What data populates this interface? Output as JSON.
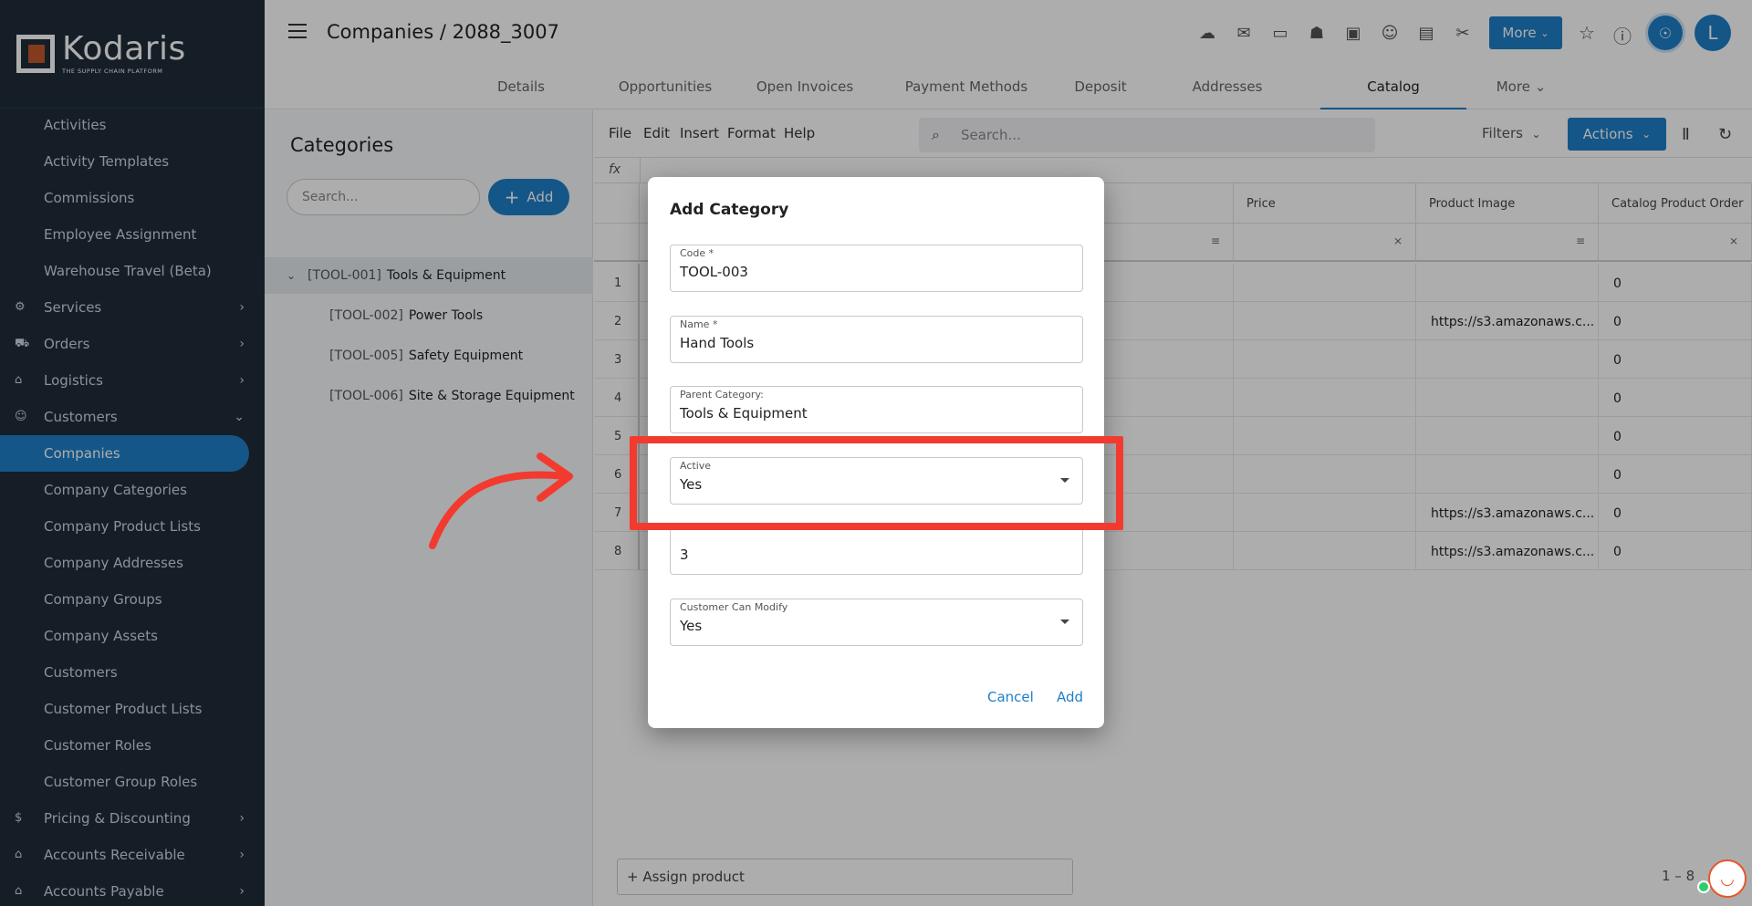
{
  "brand": {
    "name": "Kodaris",
    "tagline": "THE SUPPLY CHAIN PLATFORM"
  },
  "sidebar": {
    "items": [
      {
        "label": "Activities",
        "type": "sub"
      },
      {
        "label": "Activity Templates",
        "type": "sub"
      },
      {
        "label": "Commissions",
        "type": "sub"
      },
      {
        "label": "Employee Assignment",
        "type": "sub"
      },
      {
        "label": "Warehouse Travel (Beta)",
        "type": "sub"
      },
      {
        "label": "Services",
        "type": "section",
        "icon": "services-icon"
      },
      {
        "label": "Orders",
        "type": "section",
        "icon": "truck-icon"
      },
      {
        "label": "Logistics",
        "type": "section",
        "icon": "logistics-icon"
      },
      {
        "label": "Customers",
        "type": "section",
        "icon": "people-icon",
        "expanded": true
      },
      {
        "label": "Companies",
        "type": "sub",
        "active": true
      },
      {
        "label": "Company Categories",
        "type": "sub"
      },
      {
        "label": "Company Product Lists",
        "type": "sub"
      },
      {
        "label": "Company Addresses",
        "type": "sub"
      },
      {
        "label": "Company Groups",
        "type": "sub"
      },
      {
        "label": "Company Assets",
        "type": "sub"
      },
      {
        "label": "Customers",
        "type": "sub"
      },
      {
        "label": "Customer Product Lists",
        "type": "sub"
      },
      {
        "label": "Customer Roles",
        "type": "sub"
      },
      {
        "label": "Customer Group Roles",
        "type": "sub"
      },
      {
        "label": "Pricing & Discounting",
        "type": "section",
        "icon": "dollar-icon"
      },
      {
        "label": "Accounts Receivable",
        "type": "section",
        "icon": "bank-icon"
      },
      {
        "label": "Accounts Payable",
        "type": "section",
        "icon": "bank-icon"
      }
    ]
  },
  "header": {
    "title": "Companies / 2088_3007",
    "more_label": "More",
    "avatar_initial": "L",
    "icons": [
      "cloud-download-icon",
      "mail-icon",
      "payment-card-icon",
      "gift-icon",
      "screen-add-icon",
      "add-person-icon",
      "file-add-icon",
      "paperclip-icon"
    ]
  },
  "tabs": [
    {
      "label": "Details"
    },
    {
      "label": "Opportunities"
    },
    {
      "label": "Open Invoices"
    },
    {
      "label": "Payment Methods"
    },
    {
      "label": "Deposit"
    },
    {
      "label": "Addresses"
    },
    {
      "label": "Catalog",
      "active": true
    },
    {
      "label": "More"
    }
  ],
  "categories": {
    "title": "Categories",
    "search_placeholder": "Search...",
    "add_label": "Add",
    "items": [
      {
        "code": "[TOOL-001]",
        "name": "Tools & Equipment",
        "level": 0,
        "selected": true
      },
      {
        "code": "[TOOL-002]",
        "name": "Power Tools",
        "level": 1
      },
      {
        "code": "[TOOL-005]",
        "name": "Safety Equipment",
        "level": 1
      },
      {
        "code": "[TOOL-006]",
        "name": "Site & Storage Equipment",
        "level": 1
      }
    ]
  },
  "grid": {
    "menu": [
      "File",
      "Edit",
      "Insert",
      "Format",
      "Help"
    ],
    "search_placeholder": "Search...",
    "filters_label": "Filters",
    "actions_label": "Actions",
    "fx_label": "fx",
    "columns": [
      "Price",
      "Product Image",
      "Catalog Product Order"
    ],
    "rows": [
      {
        "num": "1",
        "price": "",
        "image": "",
        "order": "0"
      },
      {
        "num": "2",
        "price": "",
        "image": "https://s3.amazonaws.c...",
        "order": "0"
      },
      {
        "num": "3",
        "price": "",
        "image": "",
        "order": "0"
      },
      {
        "num": "4",
        "price": "",
        "image": "",
        "order": "0"
      },
      {
        "num": "5",
        "price": "",
        "image": "",
        "order": "0"
      },
      {
        "num": "6",
        "price": "",
        "image": "",
        "order": "0"
      },
      {
        "num": "7",
        "price": "",
        "image": "https://s3.amazonaws.c...",
        "order": "0"
      },
      {
        "num": "8",
        "price": "",
        "image": "https://s3.amazonaws.c...",
        "order": "0"
      }
    ],
    "assign_label": "+ Assign product",
    "pager_text": "1 – 8"
  },
  "modal": {
    "title": "Add Category",
    "fields": [
      {
        "label": "Code *",
        "value": "TOOL-003"
      },
      {
        "label": "Name *",
        "value": "Hand Tools"
      },
      {
        "label": "Parent Category:",
        "value": "Tools & Equipment"
      },
      {
        "label": "Active",
        "value": "Yes",
        "select": true
      },
      {
        "label": "",
        "value": "3"
      },
      {
        "label": "Customer Can Modify",
        "value": "Yes",
        "select": true
      }
    ],
    "cancel_label": "Cancel",
    "add_label": "Add"
  },
  "annotation": {
    "highlight_color": "#f23a2f"
  },
  "colors": {
    "accent": "#1e7fc9",
    "sidebar_bg": "#1f2d3a"
  }
}
